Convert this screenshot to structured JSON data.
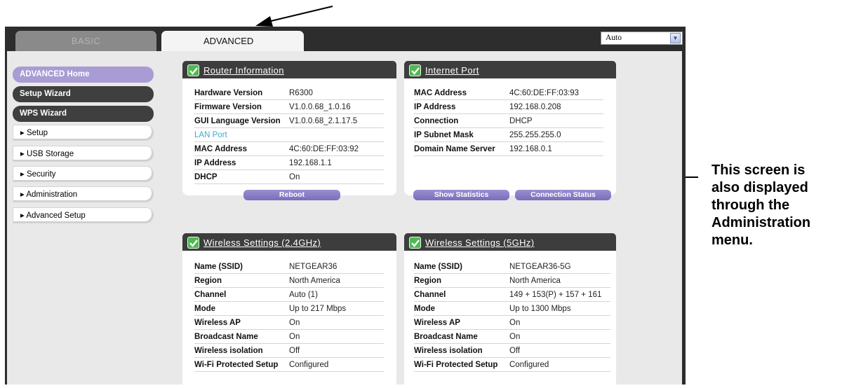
{
  "tabs": {
    "basic": "BASIC",
    "advanced": "ADVANCED"
  },
  "language": {
    "selected": "Auto"
  },
  "sidebar": {
    "items": [
      {
        "label": "ADVANCED Home"
      },
      {
        "label": "Setup Wizard"
      },
      {
        "label": "WPS Wizard"
      },
      {
        "label": "▸ Setup"
      },
      {
        "label": "▸ USB Storage"
      },
      {
        "label": "▸ Security"
      },
      {
        "label": "▸ Administration"
      },
      {
        "label": "▸ Advanced Setup"
      }
    ]
  },
  "router_info": {
    "title": "Router Information",
    "rows": [
      {
        "k": "Hardware Version",
        "v": "R6300"
      },
      {
        "k": "Firmware Version",
        "v": "V1.0.0.68_1.0.16"
      },
      {
        "k": "GUI Language Version",
        "v": "V1.0.0.68_2.1.17.5"
      },
      {
        "k": "LAN Port",
        "v": ""
      },
      {
        "k": "MAC Address",
        "v": "4C:60:DE:FF:03:92"
      },
      {
        "k": "IP Address",
        "v": "192.168.1.1"
      },
      {
        "k": "DHCP",
        "v": "On"
      }
    ],
    "button": "Reboot"
  },
  "internet_port": {
    "title": "Internet Port",
    "rows": [
      {
        "k": "MAC Address",
        "v": "4C:60:DE:FF:03:93"
      },
      {
        "k": "IP Address",
        "v": "192.168.0.208"
      },
      {
        "k": "Connection",
        "v": "DHCP"
      },
      {
        "k": "IP Subnet Mask",
        "v": "255.255.255.0"
      },
      {
        "k": "Domain Name Server",
        "v": "192.168.0.1"
      }
    ],
    "btn_stats": "Show Statistics",
    "btn_status": "Connection Status"
  },
  "wireless24": {
    "title": "Wireless Settings (2.4GHz)",
    "rows": [
      {
        "k": "Name (SSID)",
        "v": "NETGEAR36"
      },
      {
        "k": "Region",
        "v": "North America"
      },
      {
        "k": "Channel",
        "v": "Auto (1)"
      },
      {
        "k": "Mode",
        "v": "Up to 217 Mbps"
      },
      {
        "k": "Wireless AP",
        "v": "On"
      },
      {
        "k": "Broadcast Name",
        "v": "On"
      },
      {
        "k": "Wireless isolation",
        "v": "Off"
      },
      {
        "k": "Wi-Fi Protected Setup",
        "v": "Configured"
      }
    ]
  },
  "wireless5": {
    "title": "Wireless Settings (5GHz)",
    "rows": [
      {
        "k": "Name (SSID)",
        "v": "NETGEAR36-5G"
      },
      {
        "k": "Region",
        "v": "North America"
      },
      {
        "k": "Channel",
        "v": "149 + 153(P) + 157 + 161"
      },
      {
        "k": "Mode",
        "v": "Up to 1300 Mbps"
      },
      {
        "k": "Wireless AP",
        "v": "On"
      },
      {
        "k": "Broadcast Name",
        "v": "On"
      },
      {
        "k": "Wireless isolation",
        "v": "Off"
      },
      {
        "k": "Wi-Fi Protected Setup",
        "v": "Configured"
      }
    ]
  },
  "annotation": {
    "line1": "This screen is",
    "line2": "also displayed",
    "line3": "through the",
    "line4": "Administration",
    "line5": "menu."
  },
  "colors": {
    "accent": "#a99cd4",
    "check": "#4fb94f",
    "link": "#3fa9c9"
  }
}
